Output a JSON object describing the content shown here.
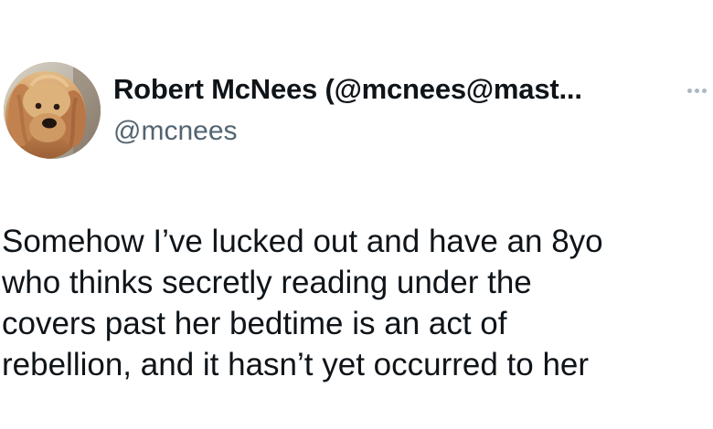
{
  "author": {
    "display_name": "Robert McNees (@mcnees@mast...",
    "handle": "@mcnees",
    "avatar_icon": "dog-avatar"
  },
  "menu": {
    "icon": "more-horizontal-icon"
  },
  "tweet": {
    "lines": [
      "Somehow I’ve lucked out and have an 8yo",
      "who thinks secretly reading under the",
      "covers past her bedtime is an act of",
      "rebellion, and it hasn’t yet occurred to her"
    ]
  },
  "colors": {
    "text": "#0f1419",
    "secondary_text": "#536471",
    "background": "#ffffff"
  }
}
